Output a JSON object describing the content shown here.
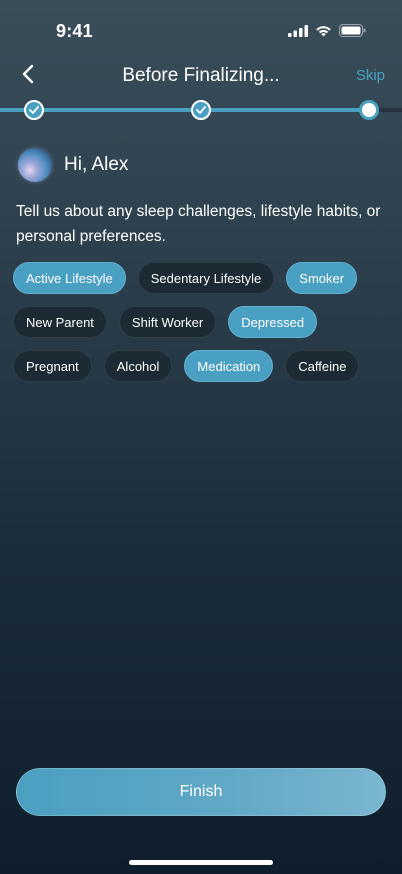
{
  "status_bar": {
    "time": "9:41",
    "icons": [
      "cellular-signal-icon",
      "wifi-icon",
      "battery-icon"
    ]
  },
  "header": {
    "back_icon": "chevron-left-icon",
    "title": "Before Finalizing...",
    "skip_label": "Skip"
  },
  "progress": {
    "steps": [
      {
        "state": "complete",
        "icon": "checkmark-icon"
      },
      {
        "state": "complete",
        "icon": "checkmark-icon"
      },
      {
        "state": "current"
      }
    ],
    "fraction_complete": 0.92
  },
  "greeting": {
    "avatar_icon": "assistant-orb-icon",
    "text": "Hi, Alex"
  },
  "prompt": "Tell us about any sleep challenges, lifestyle habits, or personal preferences.",
  "chips": [
    {
      "label": "Active Lifestyle",
      "selected": true
    },
    {
      "label": "Sedentary Lifestyle",
      "selected": false
    },
    {
      "label": "Smoker",
      "selected": true
    },
    {
      "label": "New Parent",
      "selected": false
    },
    {
      "label": "Shift Worker",
      "selected": false
    },
    {
      "label": "Depressed",
      "selected": true
    },
    {
      "label": "Pregnant",
      "selected": false
    },
    {
      "label": "Alcohol",
      "selected": false
    },
    {
      "label": "Medication",
      "selected": true
    },
    {
      "label": "Caffeine",
      "selected": false
    }
  ],
  "finish_label": "Finish",
  "colors": {
    "accent": "#4aa0c2",
    "chip_default_bg": "#1c2a33",
    "chip_selected_bg": "#4aa0c2",
    "background_top": "#3a4e5a",
    "background_bottom": "#0f1e2c"
  }
}
